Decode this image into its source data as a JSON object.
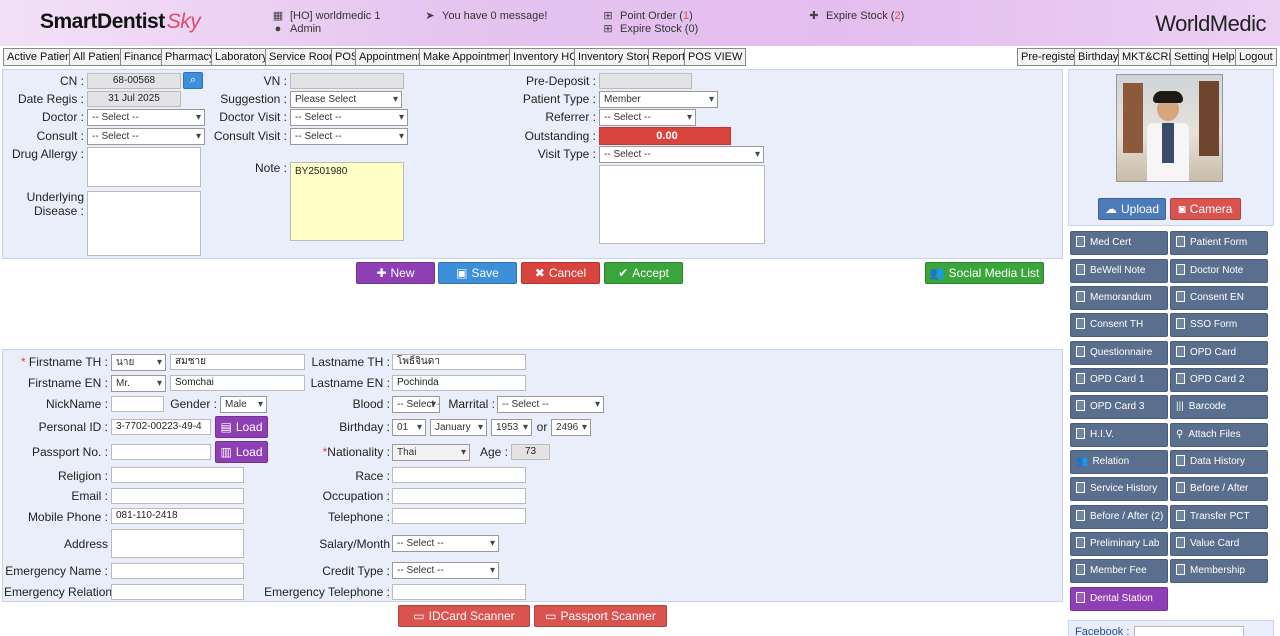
{
  "header": {
    "logo_main": "SmartDentist",
    "logo_sky": "Sky",
    "branch": "[HO] worldmedic 1",
    "user": "Admin",
    "message": "You have 0 message!",
    "point_order_label": "Point Order (",
    "point_order_count": "1",
    "point_order_close": ")",
    "expire_stock_hdr": "Expire Stock (0)",
    "expire_stock2_label": "Expire Stock (",
    "expire_stock2_count": "2",
    "expire_stock2_close": ")",
    "brand": "WorldMedic"
  },
  "menu": {
    "left": [
      "Active Patient",
      "All Patient",
      "Finance",
      "Pharmacy",
      "Laboratory",
      "Service Room",
      "POS",
      "Appointment",
      "Make Appointment",
      "Inventory HO",
      "Inventory Store",
      "Report",
      "POS VIEW"
    ],
    "right": [
      "Pre-register",
      "Birthday",
      "MKT&CRM",
      "Setting",
      "Help",
      "Logout"
    ]
  },
  "visit": {
    "cn_label": "CN :",
    "cn_value": "68-00568",
    "date_label": "Date Regis :",
    "date_value": "31 Jul 2025",
    "doctor_label": "Doctor :",
    "doctor_value": "-- Select --",
    "consult_label": "Consult :",
    "consult_value": "-- Select --",
    "drug_allergy_label": "Drug Allergy :",
    "underlying_label_1": "Underlying",
    "underlying_label_2": "Disease :",
    "vn_label": "VN :",
    "suggestion_label": "Suggestion :",
    "suggestion_value": "Please Select",
    "doctor_visit_label": "Doctor Visit :",
    "doctor_visit_value": "-- Select --",
    "consult_visit_label": "Consult Visit :",
    "consult_visit_value": "-- Select --",
    "note_label": "Note :",
    "note_value": "BY2501980",
    "predeposit_label": "Pre-Deposit :",
    "patient_type_label": "Patient Type :",
    "patient_type_value": "Member",
    "referrer_label": "Referrer :",
    "referrer_value": "-- Select --",
    "outstanding_label": "Outstanding :",
    "outstanding_value": "0.00",
    "visit_type_label": "Visit Type :",
    "visit_type_value": "-- Select --"
  },
  "actions": {
    "new": "New",
    "save": "Save",
    "cancel": "Cancel",
    "accept": "Accept",
    "social": "Social Media List"
  },
  "patient": {
    "fn_th_label": "Firstname TH :",
    "title_th": "นาย",
    "fn_th": "สมชาย",
    "ln_th_label": "Lastname TH :",
    "ln_th": "โพธิ์จินดา",
    "fn_en_label": "Firstname EN :",
    "title_en": "Mr.",
    "fn_en": "Somchai",
    "ln_en_label": "Lastname EN :",
    "ln_en": "Pochinda",
    "nick_label": "NickName :",
    "gender_label": "Gender :",
    "gender": "Male",
    "blood_label": "Blood :",
    "blood": "-- Select --",
    "marrital_label": "Marrital :",
    "marrital": "-- Select --",
    "pid_label": "Personal ID :",
    "pid": "3-7702-00223-49-4",
    "load": "Load",
    "birthday_label": "Birthday :",
    "bday_d": "01",
    "bday_m": "January",
    "bday_y": "1953",
    "or": "or",
    "bday_be": "2496",
    "passport_label": "Passport No. :",
    "nationality_label": "Nationality :",
    "nationality": "Thai",
    "age_label": "Age :",
    "age": "73",
    "religion_label": "Religion :",
    "race_label": "Race :",
    "email_label": "Email :",
    "occupation_label": "Occupation :",
    "mobile_label": "Mobile Phone :",
    "mobile": "081-110-2418",
    "telephone_label": "Telephone :",
    "address_label": "Address",
    "salary_label": "Salary/Month",
    "salary": "-- Select --",
    "emer_name_label": "Emergency Name :",
    "credit_label": "Credit Type :",
    "credit": "-- Select --",
    "emer_rel_label": "Emergency Relation :",
    "emer_tel_label": "Emergency Telephone :",
    "idcard_scanner": "IDCard Scanner",
    "passport_scanner": "Passport Scanner"
  },
  "side": {
    "upload": "Upload",
    "camera": "Camera",
    "buttons": [
      "Med Cert",
      "Patient Form",
      "BeWell Note",
      "Doctor Note",
      "Memorandum",
      "Consent EN",
      "Consent TH",
      "SSO Form",
      "Questionnaire",
      "OPD Card",
      "OPD Card 1",
      "OPD Card 2",
      "OPD Card 3",
      "Barcode",
      "H.I.V.",
      "Attach Files",
      "Relation",
      "Data History",
      "Service History",
      "Before / After",
      "Before / After (2)",
      "Transfer PCT",
      "Preliminary Lab",
      "Value Card",
      "Member Fee",
      "Membership",
      "Dental Station"
    ],
    "facebook_label": "Facebook :"
  },
  "colors": {
    "purple": "#8e3fb3",
    "blue": "#3d8fd9",
    "red": "#d9443f",
    "green": "#3aa53a",
    "side": "#5a6f8e"
  }
}
